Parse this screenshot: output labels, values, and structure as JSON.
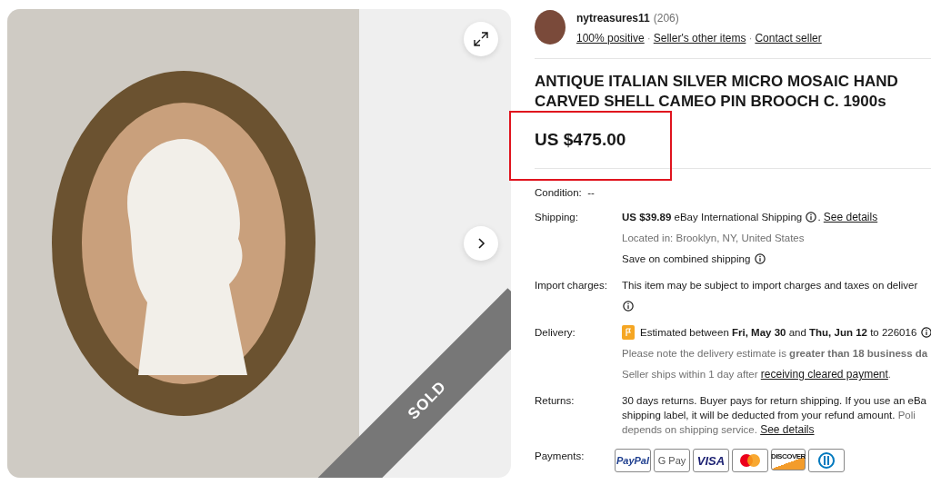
{
  "gallery": {
    "badge": "SOLD"
  },
  "seller": {
    "name": "nytreasures11",
    "count": "(206)",
    "separator": "·",
    "links": [
      "100% positive",
      "Seller's other items",
      "Contact seller"
    ]
  },
  "title": [
    "ANTIQUE ITALIAN SILVER MICRO MOSAIC HAND",
    "CARVED SHELL CAMEO PIN BROOCH C. 1900s"
  ],
  "price": "US $475.00",
  "condition": {
    "label": "Condition:",
    "value": "--"
  },
  "details": [
    {
      "label": "Shipping:",
      "kind": "list",
      "lines": [
        {
          "muted": false,
          "parts": [
            {
              "kind": "bold",
              "text": "US $39.89"
            },
            {
              "kind": "text",
              "text": " eBay International Shipping "
            },
            {
              "kind": "info"
            },
            {
              "kind": "text",
              "text": ". "
            },
            {
              "kind": "link",
              "text": "See details"
            }
          ]
        },
        {
          "muted": true,
          "parts": [
            {
              "kind": "text",
              "text": "Located in: Brooklyn, NY, United States"
            }
          ]
        },
        {
          "muted": false,
          "parts": [
            {
              "kind": "text",
              "text": "Save on combined shipping "
            },
            {
              "kind": "info"
            }
          ]
        }
      ]
    },
    {
      "label": "Import charges:",
      "kind": "list",
      "lines": [
        {
          "muted": false,
          "parts": [
            {
              "kind": "text",
              "text": "This item may be subject to import charges and taxes on deliver"
            }
          ]
        },
        {
          "parts": [
            {
              "kind": "info"
            }
          ]
        }
      ]
    },
    {
      "label": "Delivery:",
      "kind": "list",
      "lines": [
        {
          "muted": false,
          "parts": [
            {
              "kind": "flag"
            },
            {
              "kind": "text",
              "text": "Estimated between "
            },
            {
              "kind": "bold",
              "text": "Fri, May 30"
            },
            {
              "kind": "text",
              "text": " and "
            },
            {
              "kind": "bold",
              "text": "Thu, Jun 12"
            },
            {
              "kind": "text",
              "text": " to 226016 "
            },
            {
              "kind": "info"
            }
          ]
        },
        {
          "muted": true,
          "parts": [
            {
              "kind": "text",
              "text": "Please note the delivery estimate is "
            },
            {
              "kind": "bold",
              "text": "greater than 18 business da"
            }
          ]
        },
        {
          "muted": true,
          "parts": [
            {
              "kind": "text",
              "text": "Seller ships within 1 day after "
            },
            {
              "kind": "link",
              "text": "receiving cleared payment"
            },
            {
              "kind": "text",
              "text": "."
            }
          ]
        }
      ]
    },
    {
      "label": "Returns:",
      "kind": "paragraph",
      "lines": [
        {
          "muted": false,
          "parts": [
            {
              "kind": "text",
              "text": "30 days returns. Buyer pays for return shipping. If you use an eBa"
            }
          ]
        },
        {
          "muted": false,
          "parts": [
            {
              "kind": "text",
              "text": "shipping label, it will be deducted from your refund amount. "
            },
            {
              "kind": "muted",
              "text": "Poli"
            }
          ]
        },
        {
          "muted": true,
          "parts": [
            {
              "kind": "text",
              "text": "depends on shipping service. "
            },
            {
              "kind": "link",
              "text": "See details"
            }
          ]
        }
      ]
    }
  ],
  "payments": {
    "label": "Payments:",
    "cards": [
      {
        "kind": "paypal",
        "text": "PayPal"
      },
      {
        "kind": "gpay",
        "text": "G Pay"
      },
      {
        "kind": "visa",
        "text": "VISA"
      },
      {
        "kind": "mastercard"
      },
      {
        "kind": "discover",
        "text": "DISCOVER"
      },
      {
        "kind": "diners"
      }
    ]
  }
}
